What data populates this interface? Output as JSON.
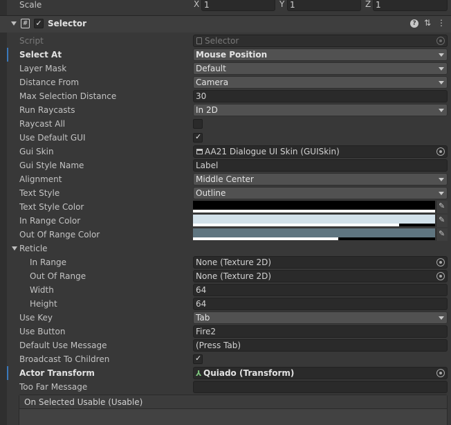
{
  "scale": {
    "label": "Scale",
    "x_label": "X",
    "x_value": "1",
    "y_label": "Y",
    "y_value": "1",
    "z_label": "Z",
    "z_value": "1"
  },
  "component": {
    "title": "Selector",
    "enabled_check": "✓",
    "script_icon": "#",
    "help_icon": "?",
    "presets_icon": "⇅",
    "menu_icon": "⋮"
  },
  "fields": {
    "script": {
      "label": "Script",
      "value": "Selector"
    },
    "select_at": {
      "label": "Select At",
      "value": "Mouse Position"
    },
    "layer_mask": {
      "label": "Layer Mask",
      "value": "Default"
    },
    "distance_from": {
      "label": "Distance From",
      "value": "Camera"
    },
    "max_selection_distance": {
      "label": "Max Selection Distance",
      "value": "30"
    },
    "run_raycasts": {
      "label": "Run Raycasts",
      "value": "In 2D"
    },
    "raycast_all": {
      "label": "Raycast All",
      "value": ""
    },
    "use_default_gui": {
      "label": "Use Default GUI",
      "value": "✓"
    },
    "gui_skin": {
      "label": "Gui Skin",
      "value": "AA21 Dialogue UI Skin (GUISkin)"
    },
    "gui_style_name": {
      "label": "Gui Style Name",
      "value": "Label"
    },
    "alignment": {
      "label": "Alignment",
      "value": "Middle Center"
    },
    "text_style": {
      "label": "Text Style",
      "value": "Outline"
    },
    "text_style_color": {
      "label": "Text Style Color",
      "color": "#000000",
      "alpha": 1.0
    },
    "in_range_color": {
      "label": "In Range Color",
      "color": "#d2e1ea",
      "alpha": 0.85
    },
    "out_of_range_color": {
      "label": "Out Of Range Color",
      "color": "#5f7580",
      "alpha": 0.6
    },
    "reticle": {
      "label": "Reticle"
    },
    "in_range": {
      "label": "In Range",
      "value": "None (Texture 2D)"
    },
    "out_of_range": {
      "label": "Out Of Range",
      "value": "None (Texture 2D)"
    },
    "width": {
      "label": "Width",
      "value": "64"
    },
    "height": {
      "label": "Height",
      "value": "64"
    },
    "use_key": {
      "label": "Use Key",
      "value": "Tab"
    },
    "use_button": {
      "label": "Use Button",
      "value": "Fire2"
    },
    "default_use_message": {
      "label": "Default Use Message",
      "value": "(Press Tab)"
    },
    "broadcast_to_children": {
      "label": "Broadcast To Children",
      "value": "✓"
    },
    "actor_transform": {
      "label": "Actor Transform",
      "value": "Quiado (Transform)"
    },
    "too_far_message": {
      "label": "Too Far Message",
      "value": ""
    }
  },
  "event": {
    "title": "On Selected Usable (Usable)"
  },
  "colors": {
    "background": "#383838",
    "field_bg": "#2a2a2a",
    "dropdown_bg": "#515151",
    "accent_mark": "#3a79bb"
  }
}
